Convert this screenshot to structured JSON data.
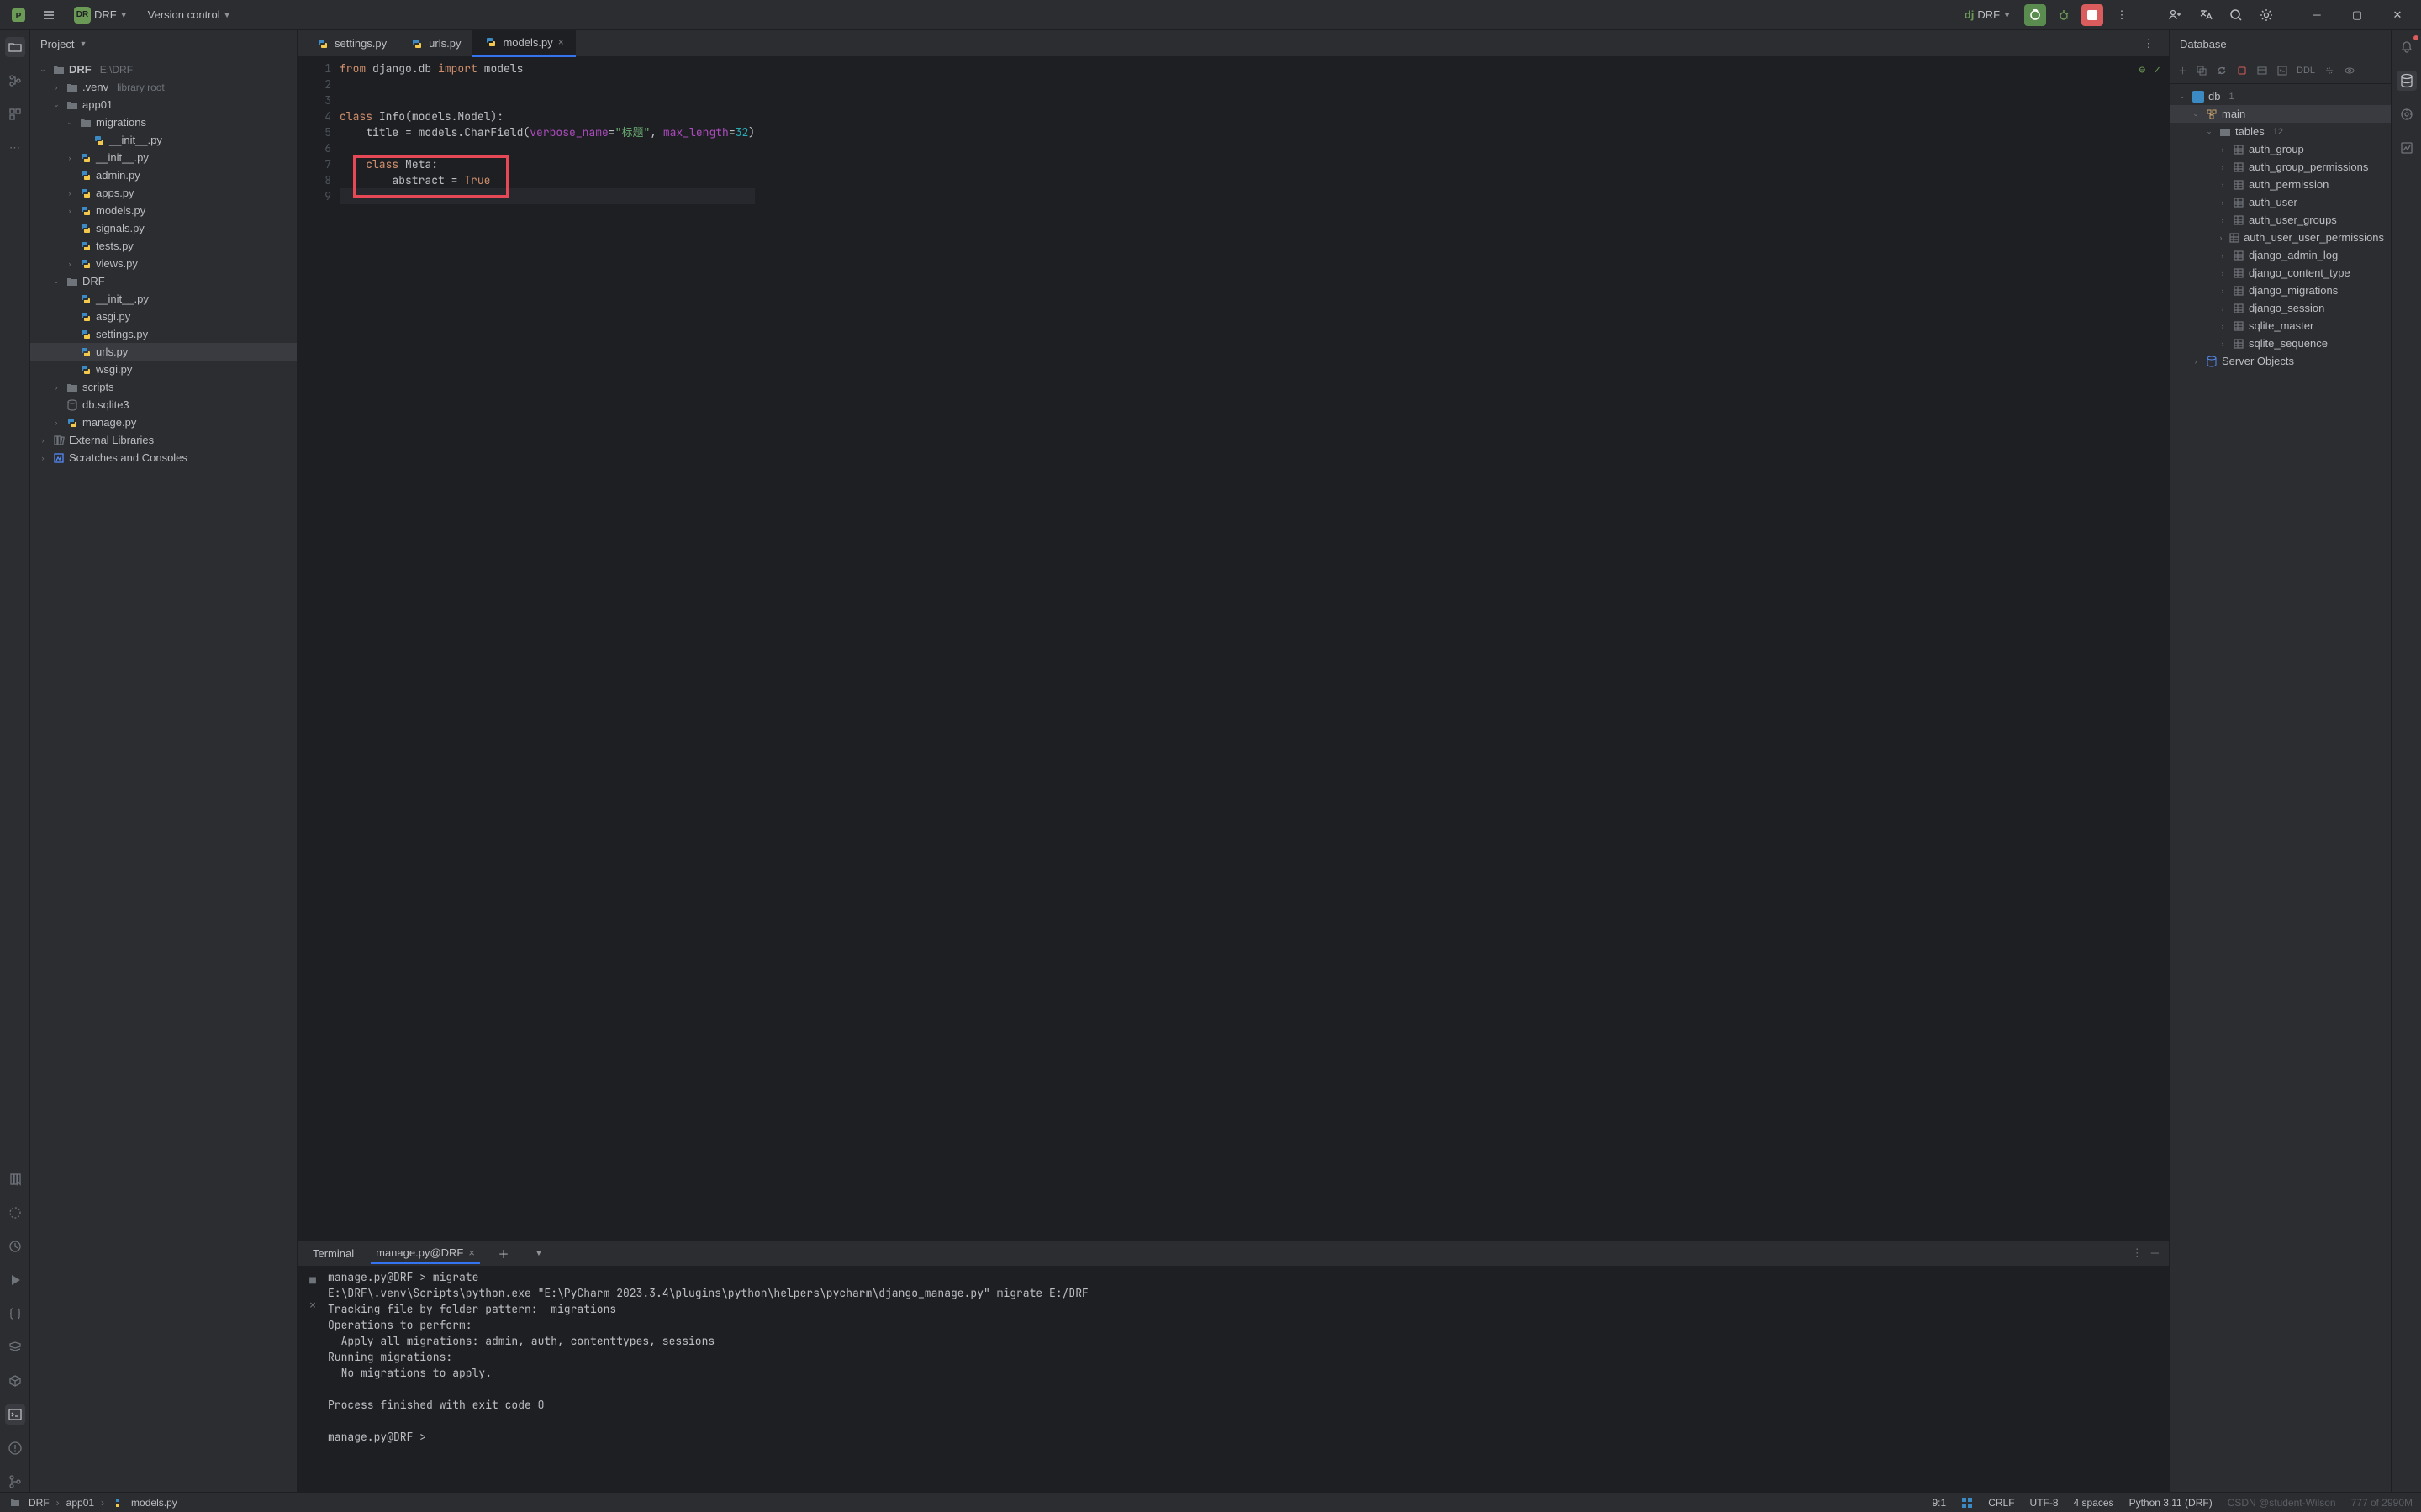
{
  "titlebar": {
    "project_badge": "DR",
    "project_name": "DRF",
    "vcs_label": "Version control",
    "run_config_prefix": "dj",
    "run_config": "DRF"
  },
  "project_panel": {
    "title": "Project",
    "root_name": "DRF",
    "root_path": "E:\\DRF",
    "items": [
      {
        "label": ".venv",
        "hint": "library root",
        "indent": 1,
        "chev": "›",
        "icon": "folder"
      },
      {
        "label": "app01",
        "indent": 1,
        "chev": "⌄",
        "icon": "folder"
      },
      {
        "label": "migrations",
        "indent": 2,
        "chev": "⌄",
        "icon": "folder"
      },
      {
        "label": "__init__.py",
        "indent": 3,
        "icon": "py"
      },
      {
        "label": "__init__.py",
        "indent": 2,
        "chev": "›",
        "icon": "py"
      },
      {
        "label": "admin.py",
        "indent": 2,
        "icon": "py"
      },
      {
        "label": "apps.py",
        "indent": 2,
        "chev": "›",
        "icon": "py"
      },
      {
        "label": "models.py",
        "indent": 2,
        "chev": "›",
        "icon": "py"
      },
      {
        "label": "signals.py",
        "indent": 2,
        "icon": "py"
      },
      {
        "label": "tests.py",
        "indent": 2,
        "icon": "py"
      },
      {
        "label": "views.py",
        "indent": 2,
        "chev": "›",
        "icon": "py"
      },
      {
        "label": "DRF",
        "indent": 1,
        "chev": "⌄",
        "icon": "folder"
      },
      {
        "label": "__init__.py",
        "indent": 2,
        "icon": "py"
      },
      {
        "label": "asgi.py",
        "indent": 2,
        "icon": "py"
      },
      {
        "label": "settings.py",
        "indent": 2,
        "icon": "py"
      },
      {
        "label": "urls.py",
        "indent": 2,
        "icon": "py",
        "selected": true
      },
      {
        "label": "wsgi.py",
        "indent": 2,
        "icon": "py"
      },
      {
        "label": "scripts",
        "indent": 1,
        "chev": "›",
        "icon": "folder"
      },
      {
        "label": "db.sqlite3",
        "indent": 1,
        "icon": "db"
      },
      {
        "label": "manage.py",
        "indent": 1,
        "chev": "›",
        "icon": "py"
      }
    ],
    "external_libs": "External Libraries",
    "scratches": "Scratches and Consoles"
  },
  "tabs": [
    {
      "name": "settings.py",
      "icon": "py"
    },
    {
      "name": "urls.py",
      "icon": "py"
    },
    {
      "name": "models.py",
      "icon": "py",
      "active": true
    }
  ],
  "code_lines": [
    {
      "n": 1,
      "html": "<span class='kw'>from</span> <span class='nm'>django.db</span> <span class='kw'>import</span> <span class='nm'>models</span>"
    },
    {
      "n": 2,
      "html": ""
    },
    {
      "n": 3,
      "html": ""
    },
    {
      "n": 4,
      "html": "<span class='kw'>class</span> <span class='nm'>Info(models.Model):</span>"
    },
    {
      "n": 5,
      "html": "    <span class='nm'>title = models.CharField(</span><span class='param'>verbose_name</span><span class='nm'>=</span><span class='str'>\"标题\"</span><span class='nm'>, </span><span class='param'>max_length</span><span class='nm'>=</span><span class='num'>32</span><span class='nm'>)</span>"
    },
    {
      "n": 6,
      "html": ""
    },
    {
      "n": 7,
      "html": "    <span class='kw'>class</span> <span class='nm'>Meta:</span>"
    },
    {
      "n": 8,
      "html": "        <span class='nm'>abstract = </span><span class='true'>True</span>"
    },
    {
      "n": 9,
      "html": "",
      "current": true
    }
  ],
  "database": {
    "title": "Database",
    "ddl_label": "DDL",
    "root": "db",
    "root_count": "1",
    "schema": "main",
    "tables_label": "tables",
    "tables_count": "12",
    "tables": [
      "auth_group",
      "auth_group_permissions",
      "auth_permission",
      "auth_user",
      "auth_user_groups",
      "auth_user_user_permissions",
      "django_admin_log",
      "django_content_type",
      "django_migrations",
      "django_session",
      "sqlite_master",
      "sqlite_sequence"
    ],
    "server_objects": "Server Objects"
  },
  "terminal": {
    "tab1": "Terminal",
    "tab2": "manage.py@DRF",
    "lines": [
      "manage.py@DRF > migrate",
      "E:\\DRF\\.venv\\Scripts\\python.exe \"E:\\PyCharm 2023.3.4\\plugins\\python\\helpers\\pycharm\\django_manage.py\" migrate E:/DRF",
      "Tracking file by folder pattern:  migrations",
      "Operations to perform:",
      "  Apply all migrations: admin, auth, contenttypes, sessions",
      "Running migrations:",
      "  No migrations to apply.",
      "",
      "Process finished with exit code 0",
      "",
      "manage.py@DRF > "
    ]
  },
  "breadcrumb": [
    "DRF",
    "app01",
    "models.py"
  ],
  "status": {
    "pos": "9:1",
    "eol": "CRLF",
    "encoding": "UTF-8",
    "indent": "4 spaces",
    "interpreter": "Python 3.11 (DRF)",
    "watermark": "CSDN @student-Wilson",
    "mem": "777 of 2990M"
  }
}
